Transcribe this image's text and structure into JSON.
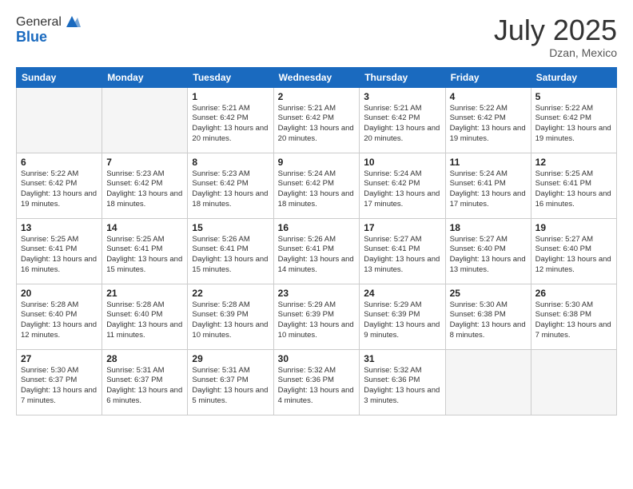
{
  "header": {
    "logo_line1": "General",
    "logo_line2": "Blue",
    "month": "July 2025",
    "location": "Dzan, Mexico"
  },
  "days_of_week": [
    "Sunday",
    "Monday",
    "Tuesday",
    "Wednesday",
    "Thursday",
    "Friday",
    "Saturday"
  ],
  "weeks": [
    [
      {
        "day": "",
        "empty": true
      },
      {
        "day": "",
        "empty": true
      },
      {
        "day": "1",
        "sunrise": "Sunrise: 5:21 AM",
        "sunset": "Sunset: 6:42 PM",
        "daylight": "Daylight: 13 hours and 20 minutes."
      },
      {
        "day": "2",
        "sunrise": "Sunrise: 5:21 AM",
        "sunset": "Sunset: 6:42 PM",
        "daylight": "Daylight: 13 hours and 20 minutes."
      },
      {
        "day": "3",
        "sunrise": "Sunrise: 5:21 AM",
        "sunset": "Sunset: 6:42 PM",
        "daylight": "Daylight: 13 hours and 20 minutes."
      },
      {
        "day": "4",
        "sunrise": "Sunrise: 5:22 AM",
        "sunset": "Sunset: 6:42 PM",
        "daylight": "Daylight: 13 hours and 19 minutes."
      },
      {
        "day": "5",
        "sunrise": "Sunrise: 5:22 AM",
        "sunset": "Sunset: 6:42 PM",
        "daylight": "Daylight: 13 hours and 19 minutes."
      }
    ],
    [
      {
        "day": "6",
        "sunrise": "Sunrise: 5:22 AM",
        "sunset": "Sunset: 6:42 PM",
        "daylight": "Daylight: 13 hours and 19 minutes."
      },
      {
        "day": "7",
        "sunrise": "Sunrise: 5:23 AM",
        "sunset": "Sunset: 6:42 PM",
        "daylight": "Daylight: 13 hours and 18 minutes."
      },
      {
        "day": "8",
        "sunrise": "Sunrise: 5:23 AM",
        "sunset": "Sunset: 6:42 PM",
        "daylight": "Daylight: 13 hours and 18 minutes."
      },
      {
        "day": "9",
        "sunrise": "Sunrise: 5:24 AM",
        "sunset": "Sunset: 6:42 PM",
        "daylight": "Daylight: 13 hours and 18 minutes."
      },
      {
        "day": "10",
        "sunrise": "Sunrise: 5:24 AM",
        "sunset": "Sunset: 6:42 PM",
        "daylight": "Daylight: 13 hours and 17 minutes."
      },
      {
        "day": "11",
        "sunrise": "Sunrise: 5:24 AM",
        "sunset": "Sunset: 6:41 PM",
        "daylight": "Daylight: 13 hours and 17 minutes."
      },
      {
        "day": "12",
        "sunrise": "Sunrise: 5:25 AM",
        "sunset": "Sunset: 6:41 PM",
        "daylight": "Daylight: 13 hours and 16 minutes."
      }
    ],
    [
      {
        "day": "13",
        "sunrise": "Sunrise: 5:25 AM",
        "sunset": "Sunset: 6:41 PM",
        "daylight": "Daylight: 13 hours and 16 minutes."
      },
      {
        "day": "14",
        "sunrise": "Sunrise: 5:25 AM",
        "sunset": "Sunset: 6:41 PM",
        "daylight": "Daylight: 13 hours and 15 minutes."
      },
      {
        "day": "15",
        "sunrise": "Sunrise: 5:26 AM",
        "sunset": "Sunset: 6:41 PM",
        "daylight": "Daylight: 13 hours and 15 minutes."
      },
      {
        "day": "16",
        "sunrise": "Sunrise: 5:26 AM",
        "sunset": "Sunset: 6:41 PM",
        "daylight": "Daylight: 13 hours and 14 minutes."
      },
      {
        "day": "17",
        "sunrise": "Sunrise: 5:27 AM",
        "sunset": "Sunset: 6:41 PM",
        "daylight": "Daylight: 13 hours and 13 minutes."
      },
      {
        "day": "18",
        "sunrise": "Sunrise: 5:27 AM",
        "sunset": "Sunset: 6:40 PM",
        "daylight": "Daylight: 13 hours and 13 minutes."
      },
      {
        "day": "19",
        "sunrise": "Sunrise: 5:27 AM",
        "sunset": "Sunset: 6:40 PM",
        "daylight": "Daylight: 13 hours and 12 minutes."
      }
    ],
    [
      {
        "day": "20",
        "sunrise": "Sunrise: 5:28 AM",
        "sunset": "Sunset: 6:40 PM",
        "daylight": "Daylight: 13 hours and 12 minutes."
      },
      {
        "day": "21",
        "sunrise": "Sunrise: 5:28 AM",
        "sunset": "Sunset: 6:40 PM",
        "daylight": "Daylight: 13 hours and 11 minutes."
      },
      {
        "day": "22",
        "sunrise": "Sunrise: 5:28 AM",
        "sunset": "Sunset: 6:39 PM",
        "daylight": "Daylight: 13 hours and 10 minutes."
      },
      {
        "day": "23",
        "sunrise": "Sunrise: 5:29 AM",
        "sunset": "Sunset: 6:39 PM",
        "daylight": "Daylight: 13 hours and 10 minutes."
      },
      {
        "day": "24",
        "sunrise": "Sunrise: 5:29 AM",
        "sunset": "Sunset: 6:39 PM",
        "daylight": "Daylight: 13 hours and 9 minutes."
      },
      {
        "day": "25",
        "sunrise": "Sunrise: 5:30 AM",
        "sunset": "Sunset: 6:38 PM",
        "daylight": "Daylight: 13 hours and 8 minutes."
      },
      {
        "day": "26",
        "sunrise": "Sunrise: 5:30 AM",
        "sunset": "Sunset: 6:38 PM",
        "daylight": "Daylight: 13 hours and 7 minutes."
      }
    ],
    [
      {
        "day": "27",
        "sunrise": "Sunrise: 5:30 AM",
        "sunset": "Sunset: 6:37 PM",
        "daylight": "Daylight: 13 hours and 7 minutes."
      },
      {
        "day": "28",
        "sunrise": "Sunrise: 5:31 AM",
        "sunset": "Sunset: 6:37 PM",
        "daylight": "Daylight: 13 hours and 6 minutes."
      },
      {
        "day": "29",
        "sunrise": "Sunrise: 5:31 AM",
        "sunset": "Sunset: 6:37 PM",
        "daylight": "Daylight: 13 hours and 5 minutes."
      },
      {
        "day": "30",
        "sunrise": "Sunrise: 5:32 AM",
        "sunset": "Sunset: 6:36 PM",
        "daylight": "Daylight: 13 hours and 4 minutes."
      },
      {
        "day": "31",
        "sunrise": "Sunrise: 5:32 AM",
        "sunset": "Sunset: 6:36 PM",
        "daylight": "Daylight: 13 hours and 3 minutes."
      },
      {
        "day": "",
        "empty": true
      },
      {
        "day": "",
        "empty": true
      }
    ]
  ]
}
